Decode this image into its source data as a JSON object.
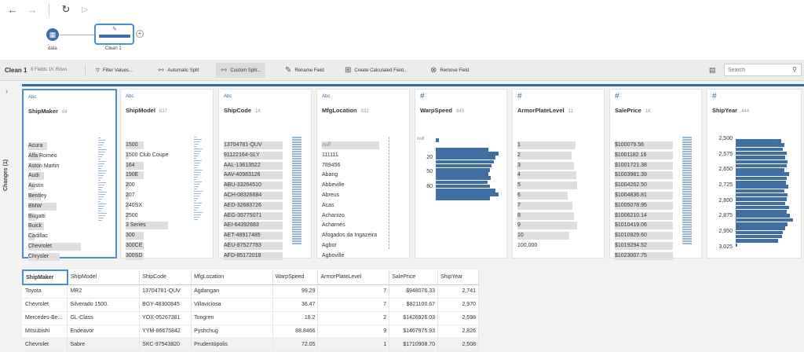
{
  "flow": {
    "input_label": "data",
    "clean_label": "Clean 1"
  },
  "toolbar": {
    "title": "Clean 1",
    "meta": "8 Fields  1K Rows",
    "filter": "Filter Values...",
    "auto_split": "Automatic Split",
    "custom_split": "Custom Split...",
    "rename": "Rename Field",
    "calc": "Create Calculated Field...",
    "remove": "Remove Field",
    "search_placeholder": "Search"
  },
  "changes": {
    "label": "Changes (1)"
  },
  "cards": [
    {
      "name": "ShipMaker",
      "type": "Abc",
      "count": "64",
      "values": [
        "Acura",
        "Alfa Romeo",
        "Aston Martin",
        "Audi",
        "Austin",
        "Bentley",
        "BMW",
        "Bugatti",
        "Buick",
        "Cadillac",
        "Chevrolet",
        "Chrysler"
      ],
      "fill": [
        0.3,
        0.2,
        0.2,
        0.25,
        0.1,
        0.2,
        0.45,
        0.12,
        0.25,
        0.1,
        0.85,
        0.5
      ]
    },
    {
      "name": "ShipModel",
      "type": "Abc",
      "count": "637",
      "values": [
        "1500",
        "1500 Club Coupe",
        "164",
        "190E",
        "200",
        "207",
        "240SX",
        "2500",
        "3 Series",
        "300",
        "300CE",
        "300SD"
      ],
      "fill": [
        0.3,
        0.05,
        0.3,
        0.3,
        0.05,
        0.05,
        0.05,
        0.05,
        0.7,
        0.3,
        0.3,
        0.3
      ]
    },
    {
      "name": "ShipCode",
      "type": "Abc",
      "count": "1K",
      "values": [
        "13704781-QUV",
        "91122164-SLY",
        "AAL-13613522",
        "AAV-40983126",
        "ABU-33264510",
        "ACH-08326684",
        "AED-32683726",
        "AEG-35775071",
        "AEI-64392683",
        "AET-48917485",
        "AEU-87527783",
        "AFD-85172018"
      ],
      "fill": [
        0.95,
        0.95,
        0.95,
        0.95,
        0.95,
        0.95,
        0.95,
        0.95,
        0.95,
        0.95,
        0.95,
        0.95
      ]
    },
    {
      "name": "MfgLocation",
      "type": "Abc",
      "count": "832",
      "values": [
        "null",
        "111111",
        "789456",
        "Abang",
        "Abbeville",
        "Abreus",
        "Acas",
        "Achanizo",
        "Acharnés",
        "Afogados da Ingazeira",
        "Agbor",
        "Agboville"
      ],
      "fill": [
        0.95,
        0,
        0,
        0,
        0,
        0,
        0,
        0,
        0,
        0,
        0,
        0
      ]
    },
    {
      "name": "WarpSpeed",
      "type": "#",
      "count": "945",
      "axis": [
        "null",
        "20",
        "50",
        "80"
      ],
      "bars": [
        0.05,
        0.8,
        0.95,
        0.9,
        0.88,
        0.85,
        0.82,
        0.8,
        0.83,
        0.78,
        0.82,
        0.9,
        0.95,
        0.82
      ]
    },
    {
      "name": "ArmorPlateLevel",
      "type": "#",
      "count": "11",
      "values": [
        "1",
        "2",
        "3",
        "4",
        "5",
        "6",
        "7",
        "8",
        "9",
        "10",
        "100,000"
      ],
      "fill": [
        0.95,
        0.88,
        0.92,
        0.96,
        0.98,
        0.82,
        0.9,
        0.92,
        0.97,
        0.85,
        0
      ]
    },
    {
      "name": "SalePrice",
      "type": "#",
      "count": "1K",
      "values": [
        "$100079.56",
        "$1001182.16",
        "$1001721.38",
        "$1003981.39",
        "$1004262.50",
        "$1004836.81",
        "$1005078.95",
        "$1006210.14",
        "$1010419.06",
        "$1010929.60",
        "$1019294.52",
        "$1023007.75"
      ],
      "fill": [
        0.95,
        0.95,
        0.95,
        0.95,
        0.95,
        0.95,
        0.95,
        0.95,
        0.95,
        0.95,
        0.95,
        0.95
      ]
    },
    {
      "name": "ShipYear",
      "type": "#",
      "count": "444",
      "axis": [
        "2,500",
        "2,575",
        "2,650",
        "2,725",
        "2,800",
        "2,875",
        "2,950",
        "3,025"
      ],
      "bars": [
        0.75,
        0.8,
        0.78,
        0.85,
        0.82,
        0.86,
        0.84,
        0.8,
        0.88,
        0.85,
        0.83,
        0.87,
        0.8,
        0.86,
        0.84,
        0.82,
        0.88,
        0.85,
        0.9,
        0.95,
        0.86,
        0.82,
        0.78,
        0.76,
        0.7,
        0.02
      ]
    }
  ],
  "table": {
    "headers": [
      "ShipMaker",
      "ShipModel",
      "ShipCode",
      "MfgLocation",
      "WarpSpeed",
      "ArmorPlateLevel",
      "SalePrice",
      "ShipYear"
    ],
    "rows": [
      [
        "Toyota",
        "MR2",
        "13704781-QUV",
        "Agdangan",
        "99.29",
        "7",
        "$948076.33",
        "2,741"
      ],
      [
        "Chevrolet",
        "Silverado 1500.",
        "BGY-48300845",
        "Villaviciosa",
        "36.47",
        "7",
        "$821100.67",
        "2,970"
      ],
      [
        "Mercedes-Be...",
        "GL-Class",
        "YOX-05267381",
        "Tongren",
        "18.2",
        "2",
        "$1426926.03",
        "2,598"
      ],
      [
        "Mitsubishi",
        "Endeavor",
        "YYM-86675842",
        "Pyshchug",
        "88.8466",
        "9",
        "$1467975.93",
        "2,826"
      ],
      [
        "Chevrolet",
        "Sabre",
        "SKC-97543820",
        "Prudentópolis",
        "72.05",
        "1",
        "$1710908.70",
        "2,508"
      ]
    ]
  }
}
